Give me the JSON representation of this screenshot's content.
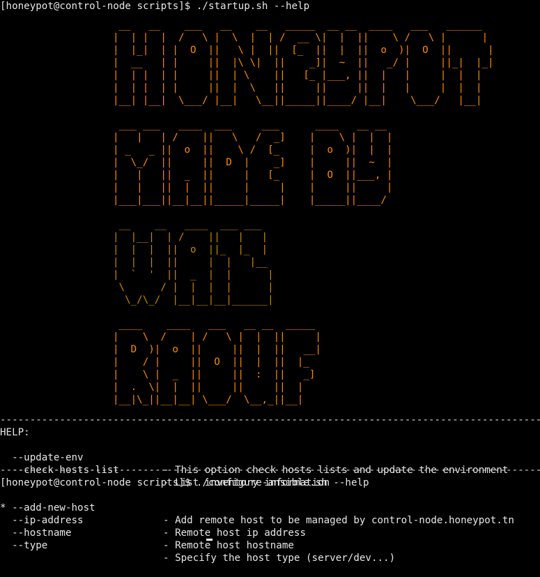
{
  "terminal": {
    "prompt_1": "[honeypot@control-node scripts]$ ./startup.sh --help",
    "banner": [
      {
        "color": "orange",
        "lines": [
          " __   __    ___   __    __   _____  __ __  ____   ___   ______",
          "|  | |  |  /   \\ |  \\  |  | /  __ \\|  |  ||    \\ /   \\ |      |",
          "|  |_|  | |  O  ||   \\ |  ||  [_  ||  |  ||  o  )|  O  ||      |",
          "|  __   | |     ||  |\\ \\|  ||    _]|  ~  ||   _/ |     ||_|  |_|",
          "|  | |  | |     ||  | \\    ||   [_ |___, ||  |   |     |  |  |",
          "|  | |  | |     ||  |  \\   ||     ||     ||  |   |     |  |  |",
          "|__| |__|  \\___/ |__|   \\__||_____||____/ |__|    \\___/   |__|"
        ]
      },
      {
        "color": "orange",
        "lines": [
          " ___ ___   ____  ___     ___      ____   __ __",
          "|   |   | /    ||   \\   /  _]    |    \\ |  |  |",
          "| _   _ ||  o  ||    \\ /  [_     |  o  )|  |  |",
          "|  \\_/  ||     ||  D  |    _]    |     ||  ~  |",
          "|   |   ||  _  ||     |   [_     |  O  ||___, |",
          "|   |   ||  |  ||     |     |    |     ||     |",
          "|___|___||__|__||_____|_____|    |_____||____/"
        ]
      },
      {
        "color": "amber",
        "lines": [
          " __    __   ____  ___ ___",
          "|  |__|  | /    ||   |   |",
          "|  |  |  ||  o  ||_  |_  |",
          "|  |  |  ||     |  |   |__",
          "|  `  '  ||  _  |  |      |",
          " \\      / |  |  |  |      |",
          "  \\_/\\_/  |__|__|__|______|"
        ]
      },
      {
        "color": "orange",
        "lines": [
          " ____    ____   ___   __ __  _____",
          "|    \\  /    | /   \\ |  |  ||     |",
          "|  D  )|  o  ||     ||  |  ||   __|",
          "|    / |     ||  O  ||  |  ||  |_",
          "|    \\ |  _  ||     ||  :  ||   _]",
          "|  .  \\|  |  ||     ||     ||  |",
          "|__|\\_||__|__| \\___/  \\__,_||__|"
        ]
      }
    ],
    "separator": "-------------------------------------------------------------------------------------------",
    "help_header": "HELP:",
    "startup_options": [
      {
        "flag": "  --update-env",
        "desc": "- This option check hosts lists and update the environment"
      },
      {
        "flag": "  --check-hosts-list",
        "desc": "- List inventory information"
      }
    ],
    "prompt_2": "[honeypot@control-node scripts]$ ./configure-ansible.sh --help",
    "ansible_options": [
      {
        "flag": "* --add-new-host",
        "desc": "- Add remote host to be managed by control-node.honeypot.tn"
      },
      {
        "flag": "  --ip-address",
        "desc": "- Remote host ip address"
      },
      {
        "flag": "  --hostname",
        "desc": "- Remote host hostname"
      },
      {
        "flag": "  --type",
        "desc": "- Specify the host type (server/dev...)"
      }
    ]
  }
}
